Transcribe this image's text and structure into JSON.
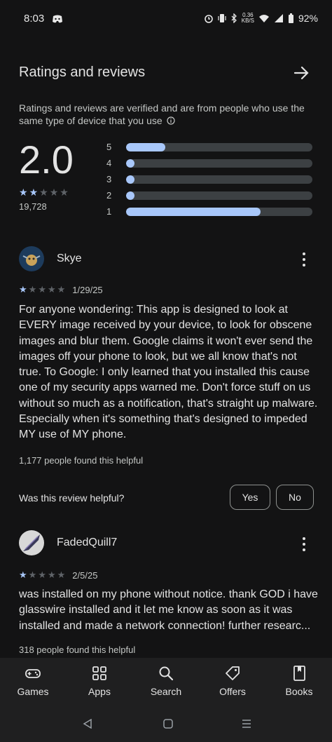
{
  "status_bar": {
    "time": "8:03",
    "network_speed": "0.36\nKB/S",
    "battery": "92%"
  },
  "section": {
    "title": "Ratings and reviews",
    "info": "Ratings and reviews are verified and are from people who use the same type of device that you use",
    "rating": "2.0",
    "rating_stars": 2,
    "count": "19,728",
    "bars": [
      {
        "label": "5",
        "fraction": 0.21
      },
      {
        "label": "4",
        "fraction": 0.04
      },
      {
        "label": "3",
        "fraction": 0.04
      },
      {
        "label": "2",
        "fraction": 0.04
      },
      {
        "label": "1",
        "fraction": 0.72
      }
    ]
  },
  "reviews": [
    {
      "name": "Skye",
      "stars": 1,
      "date": "1/29/25",
      "text": "For anyone wondering: This app is designed to look at EVERY image received by your device, to look for obscene images and blur them. Google claims it won't ever send the images off your phone to look, but we all know that's not true. To Google: I only learned that you installed this cause one of my security apps warned me. Don't force stuff on us without so much as a notification, that's straight up malware. Especially when it's something that's designed to impeded MY use of MY phone.",
      "helpful": "1,177 people found this helpful",
      "question": "Was this review helpful?",
      "yes": "Yes",
      "no": "No"
    },
    {
      "name": "FadedQuill7",
      "stars": 1,
      "date": "2/5/25",
      "text": "was installed on my phone without notice. thank GOD i have glasswire installed and it let me know as soon as it was installed and made a network connection! further researc...",
      "helpful": "318 people found this helpful"
    }
  ],
  "nav": [
    {
      "label": "Games",
      "icon": "gamepad-icon"
    },
    {
      "label": "Apps",
      "icon": "apps-grid-icon"
    },
    {
      "label": "Search",
      "icon": "search-icon"
    },
    {
      "label": "Offers",
      "icon": "tag-icon"
    },
    {
      "label": "Books",
      "icon": "book-icon"
    }
  ],
  "colors": {
    "accent": "#a8c7fa",
    "background": "#131314",
    "track": "#3c4043"
  }
}
